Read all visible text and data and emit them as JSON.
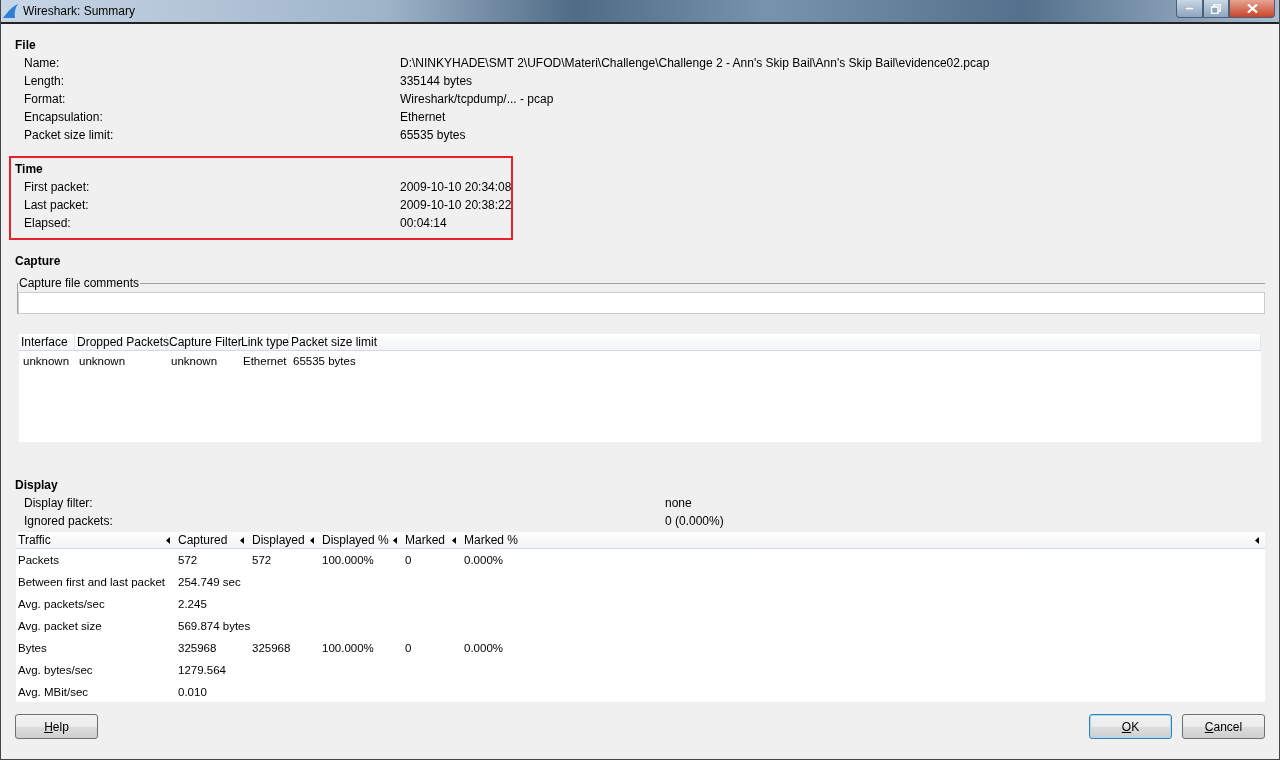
{
  "window": {
    "title": "Wireshark: Summary"
  },
  "sections": [
    {
      "heading": "File",
      "highlighted": false,
      "rows": [
        {
          "label": "Name:",
          "value": "D:\\NINKYHADE\\SMT 2\\UFOD\\Materi\\Challenge\\Challenge 2 - Ann's Skip Bail\\Ann's Skip Bail\\evidence02.pcap"
        },
        {
          "label": "Length:",
          "value": "335144 bytes"
        },
        {
          "label": "Format:",
          "value": "Wireshark/tcpdump/... - pcap"
        },
        {
          "label": "Encapsulation:",
          "value": "Ethernet"
        },
        {
          "label": "Packet size limit:",
          "value": "65535 bytes"
        }
      ]
    },
    {
      "heading": "Time",
      "highlighted": true,
      "rows": [
        {
          "label": "First packet:",
          "value": "2009-10-10 20:34:08"
        },
        {
          "label": "Last packet:",
          "value": "2009-10-10 20:38:22"
        },
        {
          "label": "Elapsed:",
          "value": "00:04:14"
        }
      ]
    }
  ],
  "capture": {
    "heading": "Capture",
    "comments": {
      "legend": "Capture file comments"
    },
    "table": {
      "columns": [
        "Interface",
        "Dropped Packets",
        "Capture Filter",
        "Link type",
        "Packet size limit"
      ],
      "rows": [
        [
          "unknown",
          "unknown",
          "unknown",
          "Ethernet",
          "65535 bytes"
        ]
      ]
    }
  },
  "display": {
    "heading": "Display",
    "rows": [
      {
        "label": "Display filter:",
        "value": "none"
      },
      {
        "label": "Ignored packets:",
        "value": "0 (0.000%)"
      }
    ],
    "traffic_table": {
      "columns": [
        {
          "label": "Traffic",
          "sort_arrow": true
        },
        {
          "label": "Captured",
          "sort_arrow": true
        },
        {
          "label": "Displayed",
          "sort_arrow": true
        },
        {
          "label": "Displayed %",
          "sort_arrow": true
        },
        {
          "label": "Marked",
          "sort_arrow": true
        },
        {
          "label": "Marked %",
          "sort_arrow": true
        }
      ],
      "rows": [
        [
          "Packets",
          "572",
          "572",
          "100.000%",
          "0",
          "0.000%"
        ],
        [
          "Between first and last packet",
          "254.749 sec"
        ],
        [
          "Avg. packets/sec",
          "2.245"
        ],
        [
          "Avg. packet size",
          "569.874 bytes"
        ],
        [
          "Bytes",
          "325968",
          "325968",
          "100.000%",
          "0",
          "0.000%"
        ],
        [
          "Avg. bytes/sec",
          "1279.564"
        ],
        [
          "Avg. MBit/sec",
          "0.010"
        ]
      ]
    }
  },
  "left_buttons": [
    {
      "label": "Help",
      "mnemonic": true,
      "default": false
    }
  ],
  "right_buttons": [
    {
      "label": "OK",
      "mnemonic": true,
      "default": true
    },
    {
      "label": "Cancel",
      "mnemonic": true,
      "default": false
    }
  ]
}
